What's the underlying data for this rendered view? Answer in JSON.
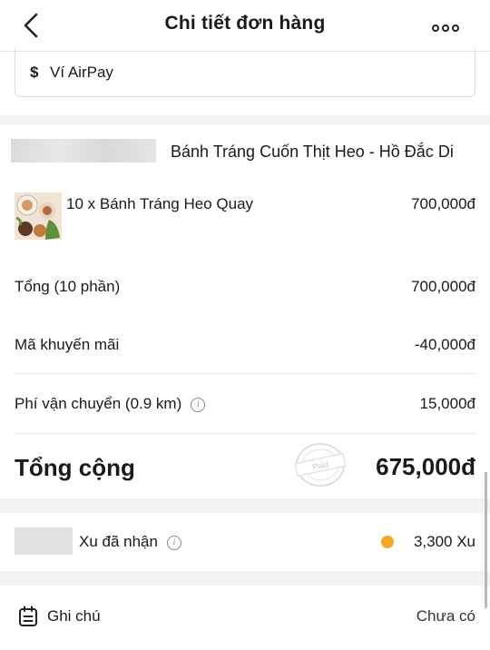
{
  "header": {
    "title": "Chi tiết đơn hàng",
    "back_icon": "chevron-left-icon",
    "more_icon": "more-horizontal-icon"
  },
  "payment": {
    "icon": "dollar-icon",
    "method": "Ví AirPay"
  },
  "order": {
    "store_name": "Bánh Tráng Cuốn Thịt Heo - Hồ Đắc Di",
    "item": {
      "name": "10 x Bánh Tráng Heo Quay",
      "price": "700,000đ"
    },
    "subtotal_label": "Tổng (10 phần)",
    "subtotal_value": "700,000đ",
    "promo_label": "Mã khuyến mãi",
    "promo_value": "-40,000đ",
    "shipping_label": "Phí vận chuyển (0.9 km)",
    "shipping_value": "15,000đ",
    "total_label": "Tổng cộng",
    "total_value": "675,000đ",
    "paid_stamp": "Paid"
  },
  "coins": {
    "label": "Xu đã nhận",
    "value": "3,300 Xu",
    "coin_color": "#f5a623"
  },
  "note": {
    "icon": "note-icon",
    "label": "Ghi chú",
    "value": "Chưa có"
  }
}
